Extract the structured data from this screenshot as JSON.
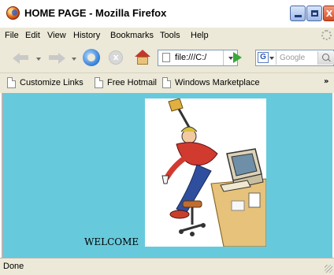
{
  "window": {
    "title": "HOME PAGE - Mozilla Firefox",
    "app_icon": "firefox-icon",
    "controls": {
      "minimize": "minimize-icon",
      "maximize": "maximize-icon",
      "close": "X"
    }
  },
  "menubar": {
    "items": [
      {
        "label": "File"
      },
      {
        "label": "Edit"
      },
      {
        "label": "View"
      },
      {
        "label": "History"
      },
      {
        "label": "Bookmarks"
      },
      {
        "label": "Tools"
      },
      {
        "label": "Help"
      }
    ],
    "throbber_icon": "throbber-icon"
  },
  "navbar": {
    "back_icon": "back-arrow-icon",
    "forward_icon": "forward-arrow-icon",
    "reload_icon": "reload-icon",
    "stop_icon": "stop-icon",
    "stop_glyph": "x",
    "home_icon": "home-icon",
    "url": "file:///C:/",
    "go_icon": "go-arrow-icon",
    "search": {
      "engine_letter": "G",
      "placeholder": "Google",
      "button_icon": "magnifier-icon"
    }
  },
  "bookmarks": {
    "items": [
      {
        "label": "Customize Links",
        "icon": "page-icon"
      },
      {
        "label": "Free Hotmail",
        "icon": "page-icon"
      },
      {
        "label": "Windows Marketplace",
        "icon": "page-icon"
      }
    ],
    "overflow": "»"
  },
  "page": {
    "background": "#67cadc",
    "welcome_text": "WELCOME",
    "image": "cartoon-man-leaning-from-office-chair-toward-computer"
  },
  "status": {
    "text": "Done"
  }
}
